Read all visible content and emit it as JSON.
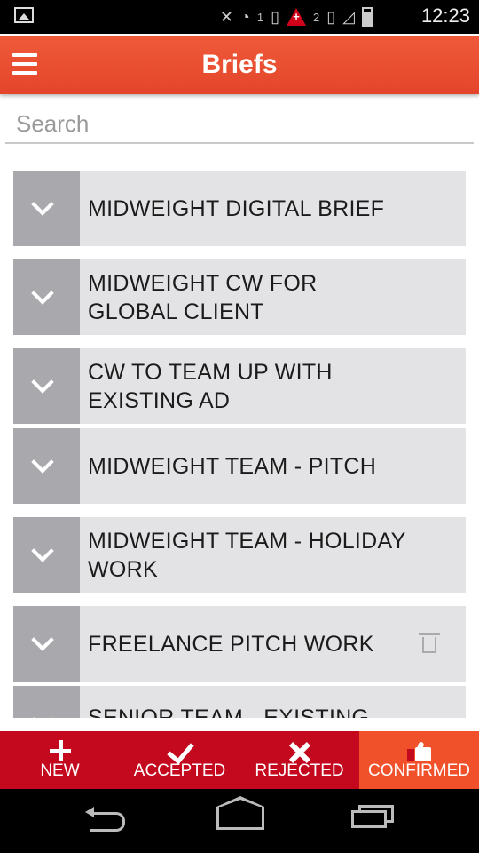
{
  "status_bar": {
    "time": "12:23",
    "sim1": "1",
    "sim2": "2",
    "icons": [
      "image-icon",
      "mute-icon",
      "wifi-icon",
      "sim-icon",
      "plus-alert-icon",
      "sim-icon",
      "signal-icon",
      "battery-icon"
    ]
  },
  "app_bar": {
    "title": "Briefs",
    "menu_icon": "hamburger-icon"
  },
  "search": {
    "placeholder": "Search",
    "value": ""
  },
  "briefs": [
    {
      "title": "MIDWEIGHT DIGITAL BRIEF"
    },
    {
      "title": "MIDWEIGHT CW FOR GLOBAL CLIENT"
    },
    {
      "title": "CW TO TEAM UP WITH EXISTING AD"
    },
    {
      "title": "MIDWEIGHT TEAM - PITCH"
    },
    {
      "title": "MIDWEIGHT TEAM - HOLIDAY WORK"
    },
    {
      "title": "FREELANCE PITCH WORK",
      "icon": "trash-icon"
    },
    {
      "title": "SENIOR TEAM - EXISTING"
    }
  ],
  "tabs": [
    {
      "label": "NEW",
      "icon": "plus-icon"
    },
    {
      "label": "ACCEPTED",
      "icon": "check-icon"
    },
    {
      "label": "REJECTED",
      "icon": "close-icon"
    },
    {
      "label": "CONFIRMED",
      "icon": "thumbs-up-icon",
      "active": true
    }
  ],
  "colors": {
    "app_bar": "#e84b2e",
    "tab_bar": "#c4091f",
    "tab_active": "#f0512a",
    "list_item_bg": "#e3e3e5",
    "toggle_bg": "#a9a9ad"
  }
}
